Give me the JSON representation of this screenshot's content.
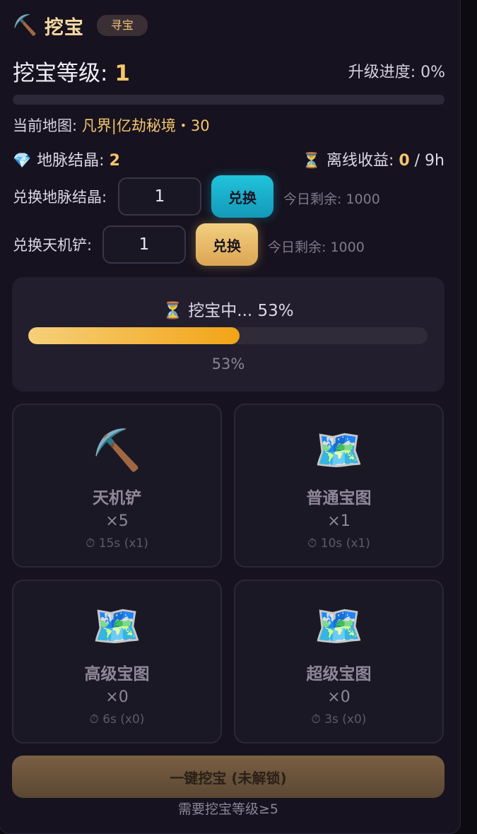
{
  "header": {
    "icon": "pickaxe-icon",
    "title": "挖宝",
    "tag": "寻宝"
  },
  "level": {
    "label": "挖宝等级: ",
    "value": "1",
    "progress_text": "升级进度: 0%",
    "progress_fraction": 0.0
  },
  "map": {
    "label": "当前地图: ",
    "value": "凡界|亿劫秘境・30"
  },
  "resources": {
    "crystal_icon": "gem-icon",
    "crystal_label": "地脉结晶: ",
    "crystal_value": "2",
    "offline_icon": "hourglass-icon",
    "offline_label": "离线收益: ",
    "offline_value": "0",
    "offline_max": " / 9h"
  },
  "exchange": [
    {
      "label": "兑换地脉结晶:",
      "input_value": "1",
      "button_label": "兑换",
      "remaining": "今日剩余: 1000",
      "accent": "#1fb8d6"
    },
    {
      "label": "兑换天机铲:",
      "input_value": "1",
      "button_label": "兑换",
      "remaining": "今日剩余: 1000",
      "accent": "#e9bb6a"
    }
  ],
  "digging": {
    "status": "⏳ 挖宝中... 53%",
    "percent_text": "53%",
    "progress_fraction": 0.53
  },
  "items": [
    {
      "icon": "pickaxe-icon",
      "glyph": "⛏️",
      "name": "天机铲",
      "count": "×5",
      "time": "⏱ 15s (x1)"
    },
    {
      "icon": "map-icon",
      "glyph": "🗺️",
      "name": "普通宝图",
      "count": "×1",
      "time": "⏱ 10s (x1)"
    },
    {
      "icon": "map-icon",
      "glyph": "🗺️",
      "name": "高级宝图",
      "count": "×0",
      "time": "⏱ 6s (x0)"
    },
    {
      "icon": "map-icon",
      "glyph": "🗺️",
      "name": "超级宝图",
      "count": "×0",
      "time": "⏱ 3s (x0)"
    }
  ],
  "onekey": {
    "label": "一键挖宝 (未解锁)",
    "requirement": "需要挖宝等级≥5"
  },
  "colors": {
    "accent_gold": "#f5c66b",
    "accent_cyan": "#1fb8d6",
    "panel_bg": "#16121f"
  }
}
